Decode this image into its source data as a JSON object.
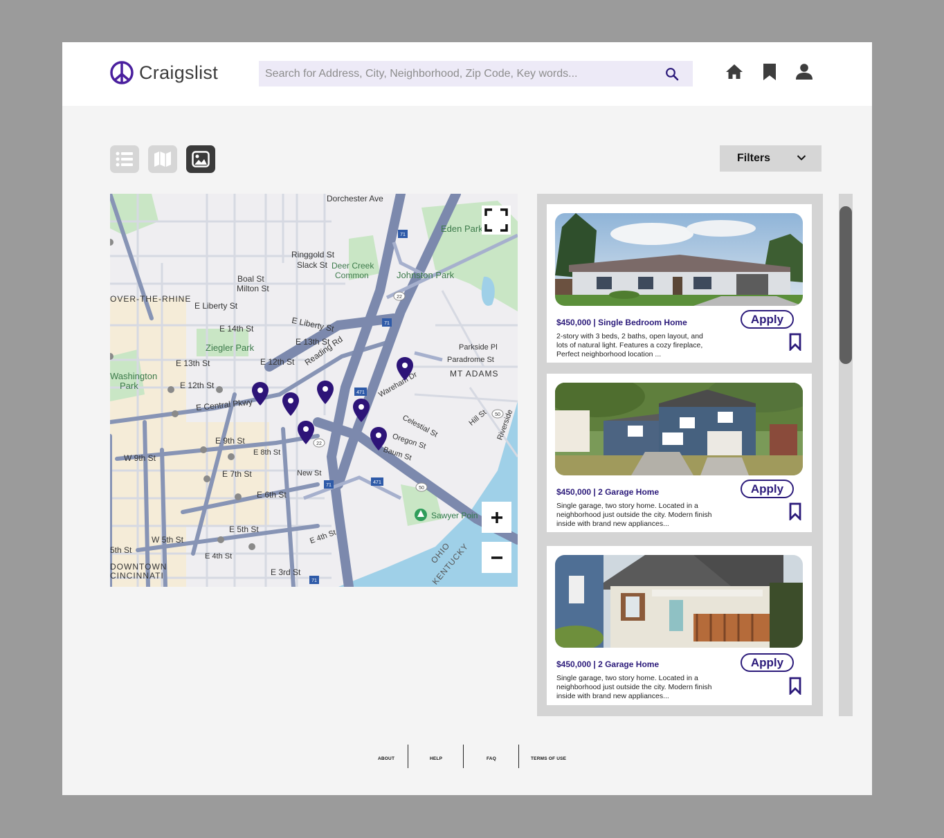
{
  "app": {
    "name": "Craigslist"
  },
  "search": {
    "placeholder": "Search for Address, City, Neighborhood, Zip Code, Key words..."
  },
  "header_icons": [
    "home-icon",
    "bookmark-icon",
    "user-icon"
  ],
  "view_toggles": [
    {
      "name": "list-view",
      "icon": "list-icon",
      "active": false
    },
    {
      "name": "map-view",
      "icon": "map-icon",
      "active": false
    },
    {
      "name": "gallery-view",
      "icon": "image-icon",
      "active": true
    }
  ],
  "filters": {
    "label": "Filters"
  },
  "map": {
    "labels": {
      "dorchester": "Dorchester Ave",
      "eden_park": "Eden Park",
      "johnston_park": "Johnston Park",
      "deer_creek": "Deer Creek",
      "common": "Common",
      "otr": "OVER-THE-RHINE",
      "liberty": "E Liberty St",
      "liberty2": "E Liberty St",
      "ziegler": "Ziegler Park",
      "washington": "Washington",
      "park": "Park",
      "central": "E Central Pkwy",
      "ninth": "E 9th St",
      "w9th": "W 9th St",
      "seventh": "E 7th St",
      "sixth": "E 6th St",
      "fifth": "E 5th St",
      "w5th": "W 5th St",
      "third": "E 3rd St",
      "mtadams": "MT ADAMS",
      "parkside": "Parkside Pl",
      "paradrome": "Paradrome St",
      "celestial": "Celestial St",
      "oregon": "Oregon St",
      "baum": "Baum St",
      "sawyer": "Sawyer Poin",
      "ohio": "OHIO",
      "kentucky": "KENTUCKY",
      "downtown": "DOWNTOWN",
      "cincinnati": "CINCINNATI",
      "reading": "Reading Rd",
      "ringgold": "Ringgold St",
      "slack": "Slack St",
      "boal": "Boal St",
      "milton": "Milton St",
      "e14th": "E 14th St",
      "e13th": "E 13th St",
      "e12th": "E 12th St",
      "e13th_w": "E 13th St",
      "e12th_w": "E 12th St",
      "e8th": "E 8th St",
      "new": "New St",
      "e4th": "E 4th St",
      "e4th_w": "E 4th St",
      "fifth_st": "5th St",
      "wareham": "Wareham Dr",
      "hill": "Hill St",
      "riverside": "Riverside"
    }
  },
  "listings": [
    {
      "title": "$450,000 | Single Bedroom Home",
      "description": "2-story with 3 beds, 2 baths, open layout, and lots of natural light. Features a cozy fireplace, Perfect neighborhood location ...",
      "apply_label": "Apply"
    },
    {
      "title": "$450,000 | 2 Garage Home",
      "description": "Single garage, two story home. Located in a neighborhood just outside the city. Modern finish inside with brand new appliances...",
      "apply_label": "Apply"
    },
    {
      "title": "$450,000 | 2 Garage Home",
      "description": "Single garage, two story home. Located in a neighborhood just outside the city. Modern finish inside with brand new appliances...",
      "apply_label": "Apply"
    }
  ],
  "footer": {
    "about": "ABOUT",
    "help": "HELP",
    "faq": "FAQ",
    "terms": "TERMS OF USE"
  },
  "colors": {
    "brand": "#2b1a7a",
    "road": "#8794b5",
    "park": "#c9e6c5",
    "water": "#9fd0e8"
  }
}
